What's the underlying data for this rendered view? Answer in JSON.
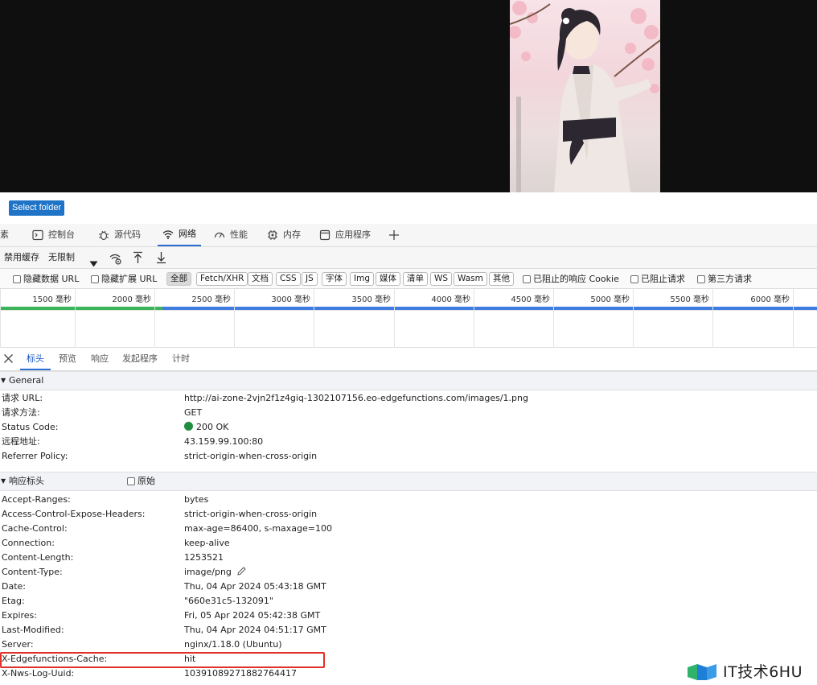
{
  "page": {
    "select_folder_label": "Select folder"
  },
  "devtools": {
    "tabs": [
      {
        "label": "素",
        "icon": ""
      },
      {
        "label": "控制台",
        "icon": "console-icon"
      },
      {
        "label": "源代码",
        "icon": "bug-icon"
      },
      {
        "label": "网络",
        "icon": "wifi-icon",
        "active": true
      },
      {
        "label": "性能",
        "icon": "gauge-icon"
      },
      {
        "label": "内存",
        "icon": "memory-chip-icon"
      },
      {
        "label": "应用程序",
        "icon": "application-window-icon"
      }
    ],
    "toolbar": {
      "disable_cache": "禁用缓存",
      "throttling": "无限制"
    },
    "filters": {
      "hide_data_url": "隐藏数据 URL",
      "hide_ext_url": "隐藏扩展 URL",
      "types": [
        "全部",
        "Fetch/XHR",
        "文档",
        "CSS",
        "JS",
        "字体",
        "Img",
        "媒体",
        "清单",
        "WS",
        "Wasm",
        "其他"
      ],
      "blocked_cookies": "已阻止的响应 Cookie",
      "blocked_requests": "已阻止请求",
      "third_party": "第三方请求"
    },
    "timeline": {
      "ticks": [
        "1500 毫秒",
        "2000 毫秒",
        "2500 毫秒",
        "3000 毫秒",
        "3500 毫秒",
        "4000 毫秒",
        "4500 毫秒",
        "5000 毫秒",
        "5500 毫秒",
        "6000 毫秒"
      ]
    },
    "subtabs": [
      "标头",
      "预览",
      "响应",
      "发起程序",
      "计时"
    ],
    "general": {
      "title": "General",
      "rows": [
        {
          "k": "请求 URL:",
          "v": "http://ai-zone-2vjn2f1z4giq-1302107156.eo-edgefunctions.com/images/1.png"
        },
        {
          "k": "请求方法:",
          "v": "GET"
        },
        {
          "k": "Status Code:",
          "v": "200 OK"
        },
        {
          "k": "远程地址:",
          "v": "43.159.99.100:80"
        },
        {
          "k": "Referrer Policy:",
          "v": "strict-origin-when-cross-origin"
        }
      ]
    },
    "response_headers": {
      "title": "响应标头",
      "raw_label": "原始",
      "rows": [
        {
          "k": "Accept-Ranges:",
          "v": "bytes"
        },
        {
          "k": "Access-Control-Expose-Headers:",
          "v": "strict-origin-when-cross-origin"
        },
        {
          "k": "Cache-Control:",
          "v": "max-age=86400, s-maxage=100"
        },
        {
          "k": "Connection:",
          "v": "keep-alive"
        },
        {
          "k": "Content-Length:",
          "v": "1253521"
        },
        {
          "k": "Content-Type:",
          "v": "image/png"
        },
        {
          "k": "Date:",
          "v": "Thu, 04 Apr 2024 05:43:18 GMT"
        },
        {
          "k": "Etag:",
          "v": "\"660e31c5-132091\""
        },
        {
          "k": "Expires:",
          "v": "Fri, 05 Apr 2024 05:42:38 GMT"
        },
        {
          "k": "Last-Modified:",
          "v": "Thu, 04 Apr 2024 04:51:17 GMT"
        },
        {
          "k": "Server:",
          "v": "nginx/1.18.0 (Ubuntu)"
        },
        {
          "k": "X-Edgefunctions-Cache:",
          "v": "hit"
        },
        {
          "k": "X-Nws-Log-Uuid:",
          "v": "10391089271882764417"
        }
      ]
    }
  },
  "watermark": "IT技术6HU"
}
